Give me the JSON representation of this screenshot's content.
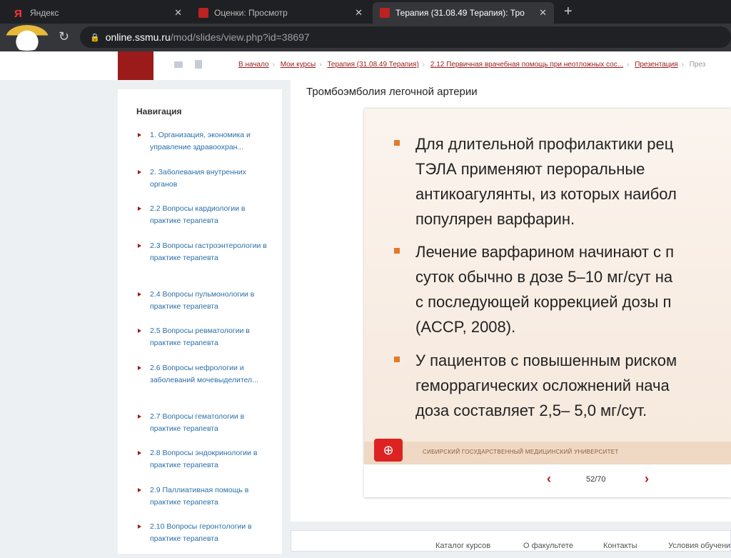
{
  "tabs": [
    {
      "label": "Яндекс",
      "active": false
    },
    {
      "label": "Оценки: Просмотр",
      "active": false
    },
    {
      "label": "Терапия (31.08.49 Терапия): Тро",
      "active": true
    }
  ],
  "url": {
    "host": "online.ssmu.ru",
    "path": "/mod/slides/view.php?id=38697"
  },
  "breadcrumbs": [
    "В начало",
    "Мои курсы",
    "Терапия (31.08.49 Терапия)",
    "2.12 Первичная врачебная помощь при неотложных сос...",
    "Презентация",
    "През"
  ],
  "sidebar": {
    "title": "Навигация",
    "items": [
      "1. Организация, экономика и управление здравоохран...",
      "2. Заболевания внутренних органов",
      "2.2 Вопросы кардиологии в практике терапевта",
      "2.3 Вопросы гастроэнтерологии в практике терапевта",
      "2.4 Вопросы пульмонологии в практике терапевта",
      "2.5 Вопросы ревматологии в практике терапевта",
      "2.6 Вопросы нефрологии и заболеваний мочевыделител...",
      "2.7 Вопросы гематологии в практике терапевта",
      "2.8 Вопросы эндокринологии в практике терапевта",
      "2.9 Паллиативная помощь в практике терапевта",
      "2.10 Вопросы геронтологии в практике терапевта"
    ]
  },
  "main": {
    "title": "Тромбоэмболия легочной артерии",
    "bullets": [
      "Для длительной профилактики рец\nТЭЛА применяют пероральные\nантикоагулянты, из которых наибол\nпопулярен варфарин.",
      "Лечение варфарином начинают с п\nсуток обычно в дозе 5–10 мг/сут на\nс последующей коррекцией дозы п\n(ACCP, 2008).",
      "У пациентов с повышенным риском\nгеморрагических осложнений нача\nдоза составляет 2,5– 5,0 мг/сут."
    ],
    "slide_footer": "СИБИРСКИЙ ГОСУДАРСТВЕННЫЙ МЕДИЦИНСКИЙ УНИВЕРСИТЕТ",
    "pager": "52/70"
  },
  "footer": [
    "Каталог курсов",
    "О факультете",
    "Контакты",
    "Условия обучени"
  ]
}
